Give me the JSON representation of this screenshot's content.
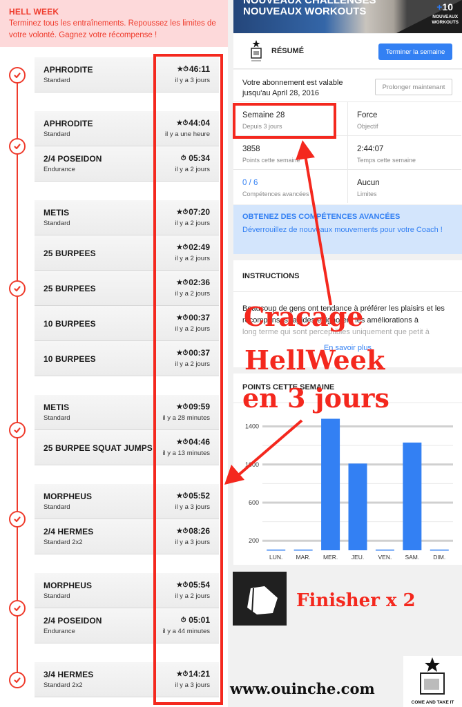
{
  "hell_week": {
    "title": "HELL WEEK",
    "description": "Terminez tous les entraînements. Repoussez les limites de votre volonté. Gagnez votre récompense !"
  },
  "workout_groups": [
    {
      "items": [
        {
          "name": "APHRODITE",
          "variant": "Standard",
          "time": "46:11",
          "ago": "il y a 3 jours",
          "icon": "star-stopwatch-icon"
        }
      ]
    },
    {
      "items": [
        {
          "name": "APHRODITE",
          "variant": "Standard",
          "time": "44:04",
          "ago": "il y a une heure",
          "icon": "star-stopwatch-icon"
        },
        {
          "name": "2/4 POSEIDON",
          "variant": "Endurance",
          "time": "05:34",
          "ago": "il y a 2 jours",
          "icon": "stopwatch-icon"
        }
      ]
    },
    {
      "items": [
        {
          "name": "METIS",
          "variant": "Standard",
          "time": "07:20",
          "ago": "il y a 2 jours",
          "icon": "star-stopwatch-icon"
        },
        {
          "name": "25 BURPEES",
          "variant": "",
          "time": "02:49",
          "ago": "il y a 2 jours",
          "icon": "half-star-stopwatch-icon"
        },
        {
          "name": "25 BURPEES",
          "variant": "",
          "time": "02:36",
          "ago": "il y a 2 jours",
          "icon": "half-star-stopwatch-icon"
        },
        {
          "name": "10 BURPEES",
          "variant": "",
          "time": "00:37",
          "ago": "il y a 2 jours",
          "icon": "half-star-stopwatch-icon"
        },
        {
          "name": "10 BURPEES",
          "variant": "",
          "time": "00:37",
          "ago": "il y a 2 jours",
          "icon": "star-stopwatch-icon"
        }
      ]
    },
    {
      "items": [
        {
          "name": "METIS",
          "variant": "Standard",
          "time": "09:59",
          "ago": "il y a 28 minutes",
          "icon": "star-stopwatch-icon"
        },
        {
          "name": "25 BURPEE SQUAT JUMPS",
          "variant": "",
          "time": "04:46",
          "ago": "il y a 13 minutes",
          "icon": "half-star-stopwatch-icon"
        }
      ]
    },
    {
      "items": [
        {
          "name": "MORPHEUS",
          "variant": "Standard",
          "time": "05:52",
          "ago": "il y a 3 jours",
          "icon": "half-star-stopwatch-icon"
        },
        {
          "name": "2/4 HERMES",
          "variant": "Standard 2x2",
          "time": "08:26",
          "ago": "il y a 3 jours",
          "icon": "half-star-stopwatch-icon"
        }
      ]
    },
    {
      "items": [
        {
          "name": "MORPHEUS",
          "variant": "Standard",
          "time": "05:54",
          "ago": "il y a 2 jours",
          "icon": "star-stopwatch-icon"
        },
        {
          "name": "2/4 POSEIDON",
          "variant": "Endurance",
          "time": "05:01",
          "ago": "il y a 44 minutes",
          "icon": "stopwatch-icon"
        }
      ]
    },
    {
      "items": [
        {
          "name": "3/4 HERMES",
          "variant": "Standard 2x2",
          "time": "14:21",
          "ago": "il y a 3 jours",
          "icon": "half-star-stopwatch-icon"
        }
      ]
    }
  ],
  "promo": {
    "line1": "NOUVEAUX CHALLENGES",
    "line2": "NOUVEAUX WORKOUTS",
    "plus": "+",
    "count": "10",
    "badge_line1": "NOUVEAUX",
    "badge_line2": "WORKOUTS"
  },
  "resume": {
    "title": "RÉSUMÉ",
    "finish_button": "Terminer la semaine",
    "subscription_text_1": "Votre abonnement est valable",
    "subscription_text_2": "jusqu'au April 28, 2016",
    "extend_button": "Prolonger maintenant",
    "stats": [
      {
        "value": "Semaine 28",
        "label": "Depuis 3 jours"
      },
      {
        "value": "Force",
        "label": "Objectif"
      },
      {
        "value": "3858",
        "label": "Points cette semaine"
      },
      {
        "value": "2:44:07",
        "label": "Temps cette semaine"
      },
      {
        "value": "0 / 6",
        "label": "Compétences avancées"
      },
      {
        "value": "Aucun",
        "label": "Limites"
      }
    ]
  },
  "advanced": {
    "title": "OBTENEZ DES COMPÉTENCES AVANCÉES",
    "description": "Déverrouillez de nouveaux mouvements pour votre Coach !"
  },
  "instructions": {
    "title": "INSTRUCTIONS",
    "body": "Beaucoup de gens ont tendance à préférer les plaisirs et les récompenses rapides et ignorent les améliorations à",
    "body_faded": "long terme qui sont perceptibles uniquement que petit à",
    "more_link": "En savoir plus"
  },
  "chart_data": {
    "type": "bar",
    "title": "POINTS CETTE SEMAINE",
    "categories": [
      "LUN.",
      "MAR.",
      "MER.",
      "JEU.",
      "VEN.",
      "SAM.",
      "DIM."
    ],
    "values": [
      0,
      0,
      1480,
      1010,
      0,
      1230,
      0
    ],
    "yticks": [
      200,
      600,
      1000,
      1400
    ],
    "minor_gridlines": [
      400,
      800,
      1200
    ],
    "ylim": [
      100,
      1520
    ],
    "xlabel": "",
    "ylabel": "",
    "grid": true,
    "color": "#3380f3"
  },
  "annotations": {
    "line1": "Cracage",
    "line2": "HellWeek",
    "line3": "en 3 jours",
    "finisher": "Finisher x 2",
    "website": "www.ouinche.com",
    "logo_caption": "COME AND TAKE IT",
    "color": "#f4281e"
  },
  "colors": {
    "accent_red": "#ef3b2c",
    "accent_blue": "#3380f3",
    "banner_pink": "#fdd9da",
    "advanced_bg": "#d3e5fc"
  }
}
